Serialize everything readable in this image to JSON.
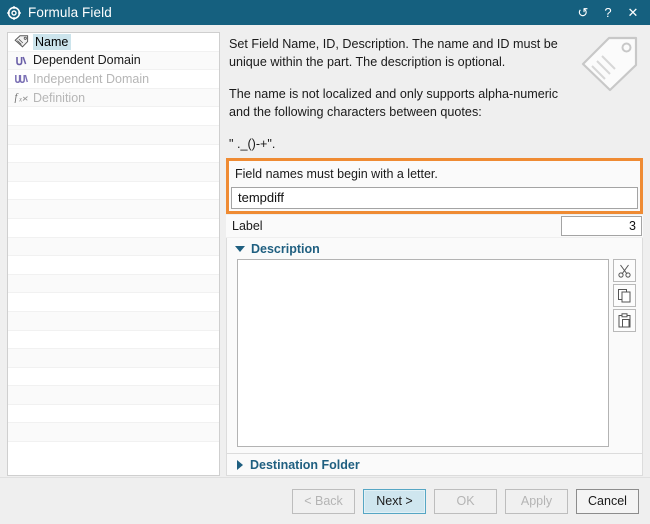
{
  "titlebar": {
    "icon": "gear-icon",
    "title": "Formula Field",
    "buttons": [
      {
        "name": "reset-icon",
        "glyph": "↺"
      },
      {
        "name": "help-icon",
        "glyph": "?"
      },
      {
        "name": "close-icon",
        "glyph": "✕"
      }
    ],
    "bg_color": "#15607f"
  },
  "sidebar": {
    "items": [
      {
        "label": "Name",
        "icon": "tag-icon",
        "state": "selected"
      },
      {
        "label": "Dependent Domain",
        "icon": "dependent-domain-icon",
        "state": "enabled"
      },
      {
        "label": "Independent Domain",
        "icon": "independent-domain-icon",
        "state": "disabled"
      },
      {
        "label": "Definition",
        "icon": "definition-icon",
        "state": "disabled"
      }
    ],
    "empty_row_count": 20
  },
  "intro": {
    "paragraph1": "Set Field Name, ID, Description.  The name and ID must be unique within the part.  The description is optional.",
    "paragraph2": "The name is not localized and only supports alpha-numeric and the following characters between quotes:",
    "characters": "\" ._()-+\".",
    "illustration_icon": "tag-illustration-icon"
  },
  "name_group": {
    "hint": "Field names must begin with a letter.",
    "input_value": "tempdiff",
    "input_placeholder": "",
    "highlight_color": "#ef8b33"
  },
  "label_row": {
    "name": "Label",
    "value": "3"
  },
  "description": {
    "title": "Description",
    "expanded": true,
    "textarea_value": "",
    "textarea_placeholder": "",
    "tools": [
      {
        "name": "cut-icon",
        "label": "Cut"
      },
      {
        "name": "copy-icon",
        "label": "Copy"
      },
      {
        "name": "paste-icon",
        "label": "Paste"
      }
    ]
  },
  "destination_folder": {
    "title": "Destination Folder",
    "expanded": false
  },
  "footer": {
    "buttons": [
      {
        "label": "< Back",
        "state": "disabled",
        "name": "back-button"
      },
      {
        "label": "Next >",
        "state": "focused",
        "name": "next-button"
      },
      {
        "label": "OK",
        "state": "disabled",
        "name": "ok-button"
      },
      {
        "label": "Apply",
        "state": "disabled",
        "name": "apply-button"
      },
      {
        "label": "Cancel",
        "state": "enabled",
        "name": "cancel-button"
      }
    ]
  }
}
